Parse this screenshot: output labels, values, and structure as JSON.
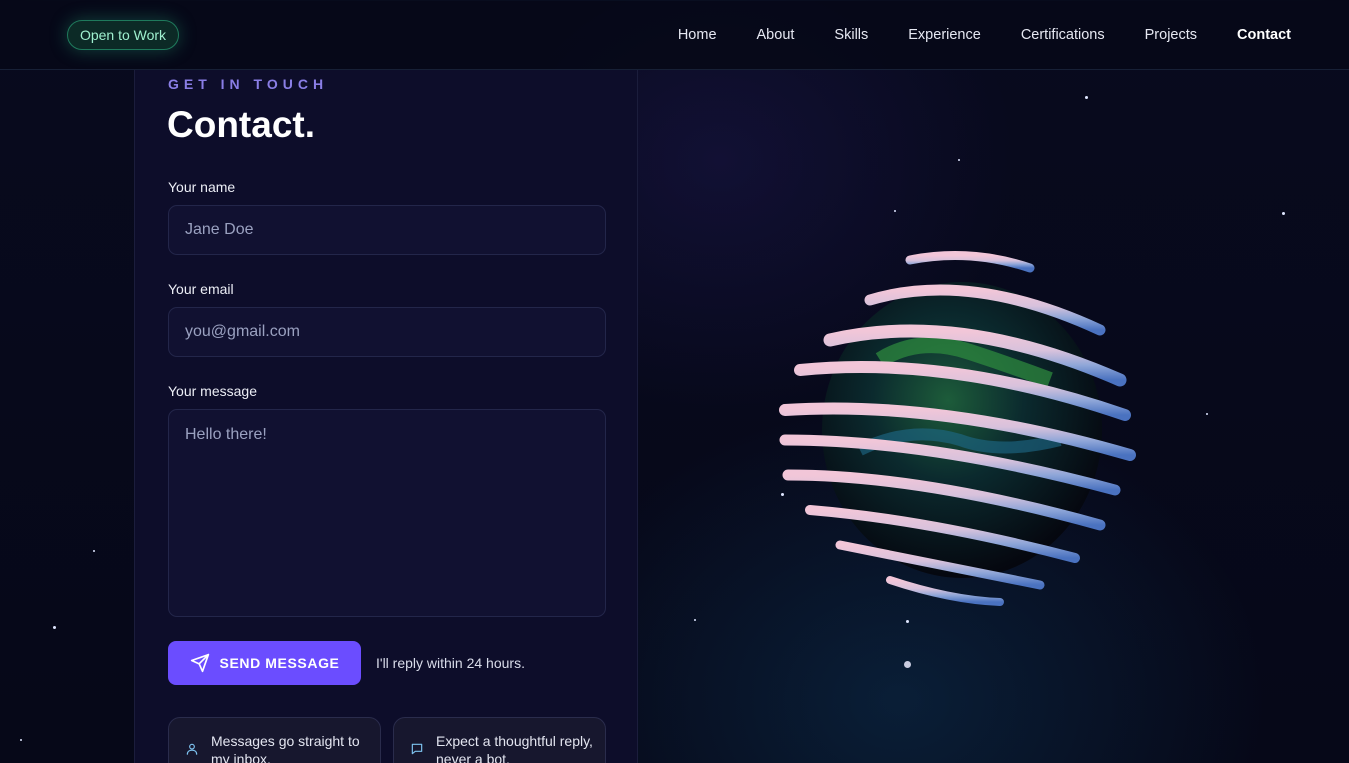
{
  "navbar": {
    "badge": "Open to Work",
    "links": [
      {
        "label": "Home",
        "active": false
      },
      {
        "label": "About",
        "active": false
      },
      {
        "label": "Skills",
        "active": false
      },
      {
        "label": "Experience",
        "active": false
      },
      {
        "label": "Certifications",
        "active": false
      },
      {
        "label": "Projects",
        "active": false
      },
      {
        "label": "Contact",
        "active": true
      }
    ]
  },
  "contact": {
    "eyebrow": "GET IN TOUCH",
    "title": "Contact.",
    "name_label": "Your name",
    "name_placeholder": "Jane Doe",
    "email_label": "Your email",
    "email_placeholder": "you@gmail.com",
    "message_label": "Your message",
    "message_placeholder": "Hello there!",
    "send_label": "SEND MESSAGE",
    "reply_note": "I'll reply within 24 hours.",
    "cards": [
      {
        "icon": "user-icon",
        "text": "Messages go straight to my inbox."
      },
      {
        "icon": "chat-bubble-icon",
        "text": "Expect a thoughtful reply, never a bot."
      }
    ]
  },
  "colors": {
    "accent": "#6b4dff",
    "eyebrow": "#8a7ee6",
    "badge_text": "#9ff0cf",
    "background": "#060818",
    "panel": "#0d0d2a"
  }
}
